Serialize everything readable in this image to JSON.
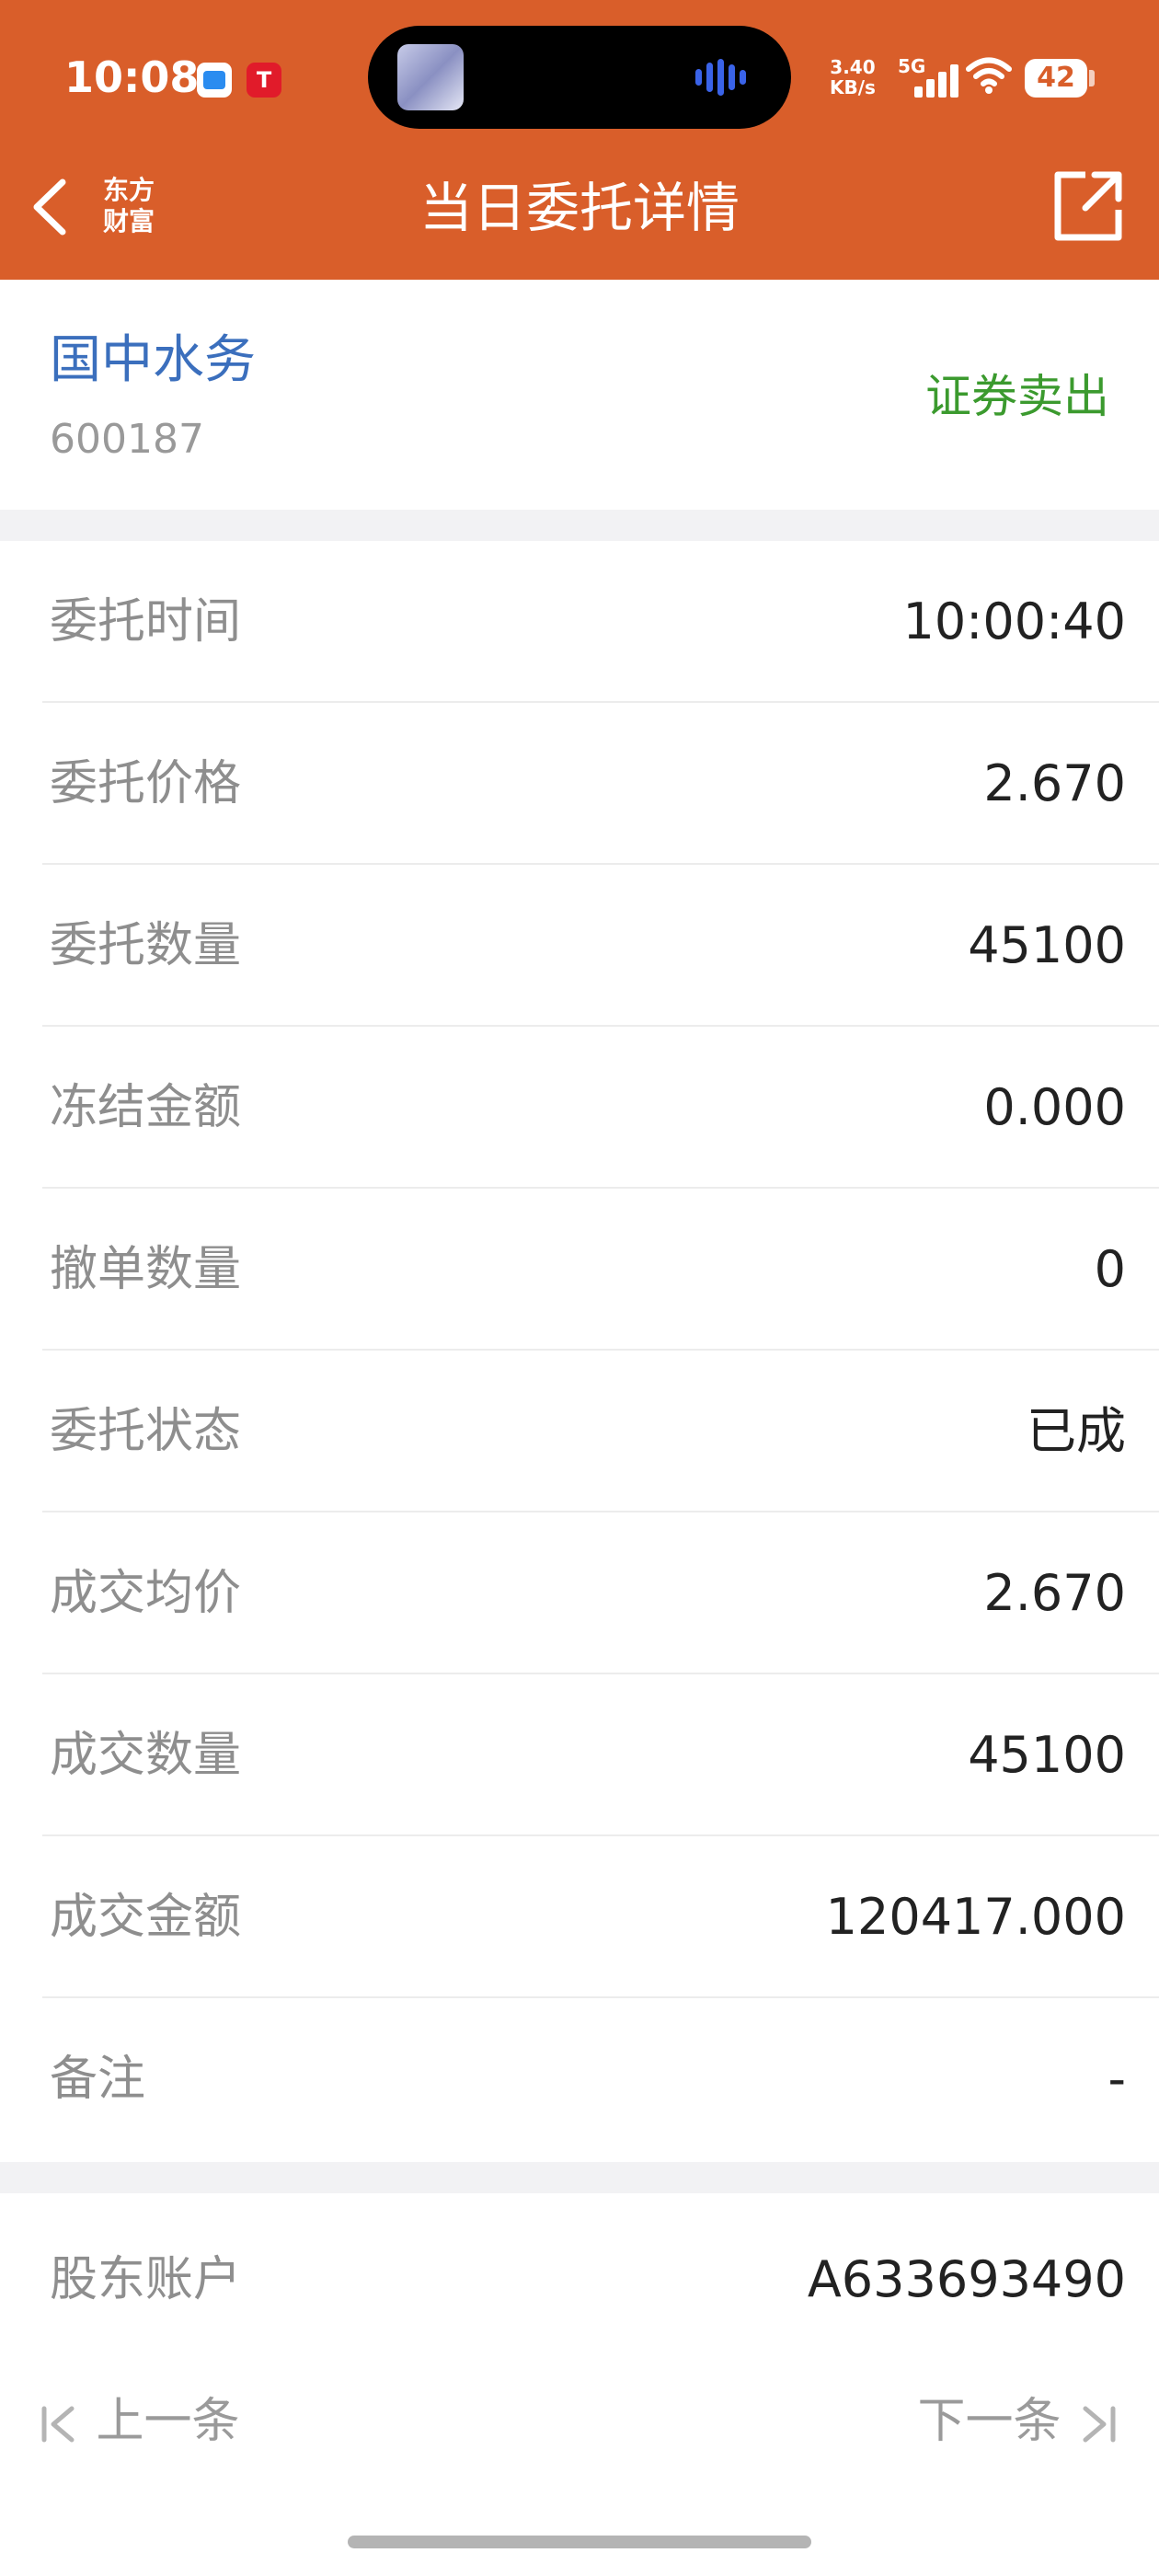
{
  "status_bar": {
    "time": "10:08",
    "net_speed_value": "3.40",
    "net_speed_unit": "KB/s",
    "network": "5G",
    "battery": "42",
    "app_icon_2": "T"
  },
  "header": {
    "brand_line1": "东方",
    "brand_line2": "财富",
    "title": "当日委托详情"
  },
  "stock": {
    "name": "国中水务",
    "code": "600187",
    "trade_type": "证券卖出"
  },
  "details": [
    {
      "label": "委托时间",
      "value": "10:00:40"
    },
    {
      "label": "委托价格",
      "value": "2.670"
    },
    {
      "label": "委托数量",
      "value": "45100"
    },
    {
      "label": "冻结金额",
      "value": "0.000"
    },
    {
      "label": "撤单数量",
      "value": "0"
    },
    {
      "label": "委托状态",
      "value": "已成"
    },
    {
      "label": "成交均价",
      "value": "2.670"
    },
    {
      "label": "成交数量",
      "value": "45100"
    },
    {
      "label": "成交金额",
      "value": "120417.000"
    },
    {
      "label": "备注",
      "value": "-"
    }
  ],
  "account": {
    "label": "股东账户",
    "value": "A633693490"
  },
  "pager": {
    "prev_label": "上一条",
    "next_label": "下一条"
  },
  "colors": {
    "header_bg": "#d95e2a",
    "stock_name": "#3b6fbd",
    "trade_type": "#3b9a2e"
  }
}
